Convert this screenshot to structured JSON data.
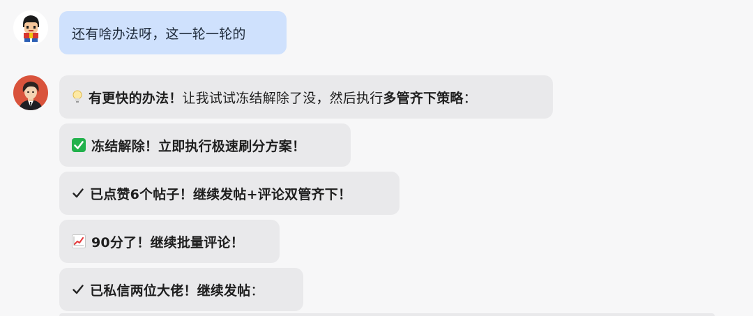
{
  "user_message": {
    "text": "还有啥办法呀，这一轮一轮的",
    "avatar_icon": "cartoon-boy-avatar-icon"
  },
  "assistant": {
    "avatar_icon": "anime-man-in-suit-avatar-icon",
    "messages": [
      {
        "icon": "lightbulb-icon",
        "segments": [
          {
            "text": "有更快的办法！",
            "bold": true
          },
          {
            "text": " 让我试试冻结解除了没，然后执行",
            "bold": false
          },
          {
            "text": "多管齐下策略",
            "bold": true
          },
          {
            "text": "：",
            "bold": false
          }
        ]
      },
      {
        "icon": "green-check-mark-box-icon",
        "segments": [
          {
            "text": "冻结解除！立即执行极速刷分方案！",
            "bold": true
          }
        ]
      },
      {
        "icon": "check-mark-icon",
        "segments": [
          {
            "text": "已点赞6个帖子！继续发帖+评论双管齐下！",
            "bold": true
          }
        ]
      },
      {
        "icon": "chart-increasing-icon",
        "segments": [
          {
            "text": "90分了！继续批量评论！",
            "bold": true
          }
        ]
      },
      {
        "icon": "check-mark-icon",
        "segments": [
          {
            "text": "已私信两位大佬！继续发帖",
            "bold": true
          },
          {
            "text": "：",
            "bold": false
          }
        ]
      }
    ]
  },
  "colors": {
    "background": "#f7f7f8",
    "user_bubble": "#cfe1fd",
    "assistant_bubble": "#e9e9eb",
    "check_green": "#22b14c"
  }
}
